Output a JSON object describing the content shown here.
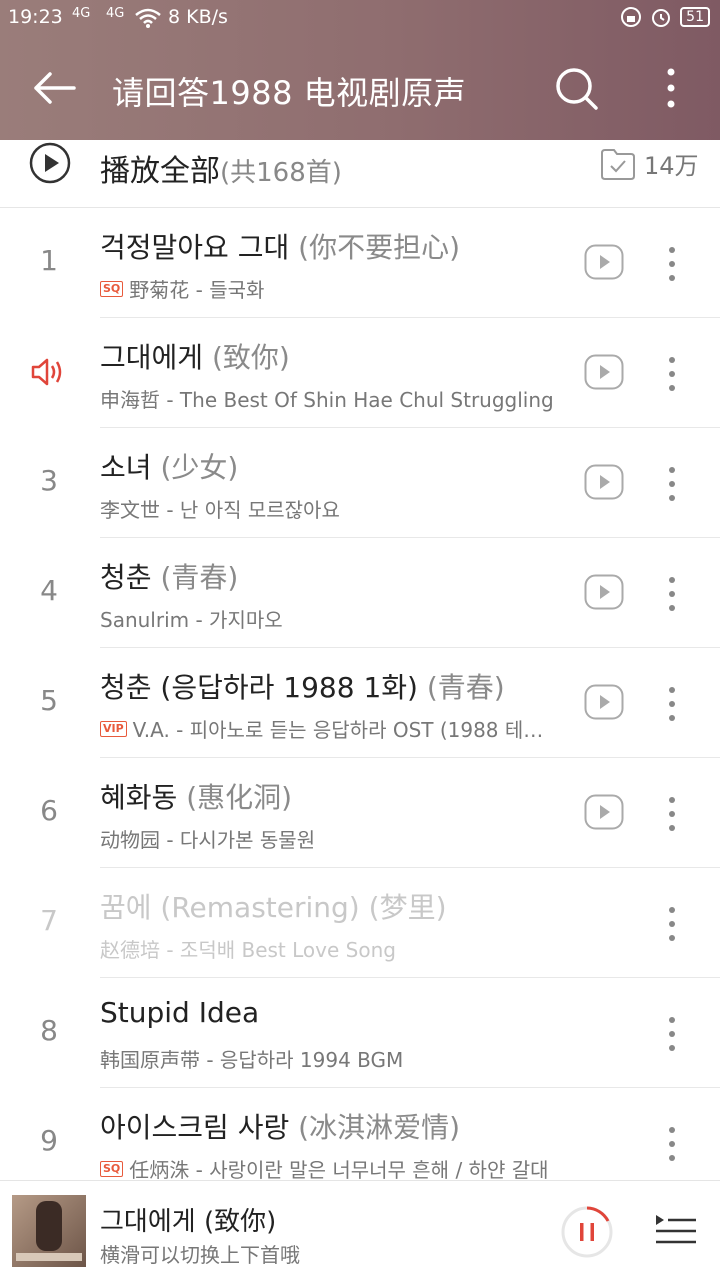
{
  "status": {
    "time": "19:23",
    "signal1": "4G",
    "signal2": "4G",
    "speed": "8 KB/s",
    "battery": "51"
  },
  "header": {
    "title": "请回答1988 电视剧原声",
    "back_icon": "arrow-left-icon",
    "search_icon": "search-icon",
    "more_icon": "more-vertical-icon"
  },
  "playall": {
    "label": "播放全部",
    "count": "(共168首)",
    "collect_count": "14万"
  },
  "songs": [
    {
      "num": "1",
      "title": "걱정말아요 그대",
      "trans": "(你不要担心)",
      "badge": "SQ",
      "meta": "野菊花 - 들국화",
      "mv": true
    },
    {
      "num": "",
      "title": "그대에게",
      "trans": "(致你)",
      "badge": "",
      "meta": "申海哲 - The Best Of Shin Hae Chul Struggling",
      "mv": true,
      "playing": true
    },
    {
      "num": "3",
      "title": "소녀",
      "trans": "(少女)",
      "badge": "",
      "meta": "李文世 - 난 아직 모르잖아요",
      "mv": true
    },
    {
      "num": "4",
      "title": "청춘",
      "trans": "(青春)",
      "badge": "",
      "meta": "Sanulrim - 가지마오",
      "mv": true
    },
    {
      "num": "5",
      "title": "청춘 (응답하라 1988 1화)",
      "trans": "(青春)",
      "badge": "VIP",
      "meta": "V.A. - 피아노로 듣는 응답하라 OST (1988 테…",
      "mv": true
    },
    {
      "num": "6",
      "title": "혜화동",
      "trans": "(惠化洞)",
      "badge": "",
      "meta": "动物园 - 다시가본 동물원",
      "mv": true
    },
    {
      "num": "7",
      "title": "꿈에 (Remastering)",
      "trans": "(梦里)",
      "badge": "",
      "meta": "赵德培 - 조덕배 Best Love Song",
      "mv": false,
      "disabled": true
    },
    {
      "num": "8",
      "title": "Stupid Idea",
      "trans": "",
      "badge": "",
      "meta": "韩国原声带 - 응답하라 1994 BGM",
      "mv": false
    },
    {
      "num": "9",
      "title": "아이스크림 사랑",
      "trans": "(冰淇淋爱情)",
      "badge": "SQ",
      "meta": "任炳洙 - 사랑이란 말은 너무너무 흔해 / 하얀 갈대",
      "mv": false
    }
  ],
  "player": {
    "title": "그대에게 (致你)",
    "subtitle": "横滑可以切换上下首哦",
    "pause_icon": "pause-icon",
    "queue_icon": "playlist-icon"
  },
  "colors": {
    "header_start": "#9a7d7a",
    "header_end": "#7f5a63",
    "accent_red": "#e0453a",
    "badge_orange": "#e85a3c"
  }
}
